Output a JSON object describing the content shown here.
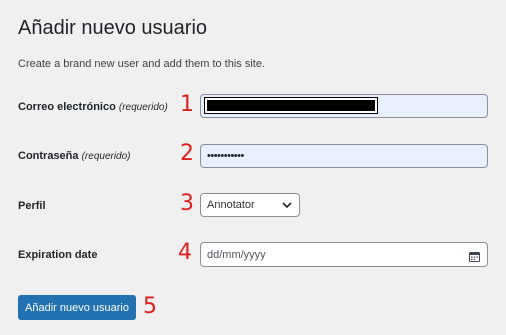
{
  "page": {
    "title": "Añadir nuevo usuario",
    "description": "Create a brand new user and add them to this site."
  },
  "fields": {
    "email": {
      "label": "Correo electrónico",
      "required": "(requerido)",
      "annotation": "1"
    },
    "password": {
      "label": "Contraseña",
      "required": "(requerido)",
      "value": "•••••••••••",
      "annotation": "2"
    },
    "role": {
      "label": "Perfil",
      "selected": "Annotator",
      "annotation": "3"
    },
    "expiration": {
      "label": "Expiration date",
      "placeholder": "dd/mm/yyyy",
      "annotation": "4"
    }
  },
  "submit": {
    "label": "Añadir nuevo usuario",
    "annotation": "5"
  },
  "colors": {
    "background": "#f0f0f1",
    "primary_button": "#2271b1",
    "autofill": "#e8f0fe",
    "annotation": "#e0201c"
  },
  "icons": {
    "select": "chevron-down-icon",
    "date": "calendar-icon"
  }
}
